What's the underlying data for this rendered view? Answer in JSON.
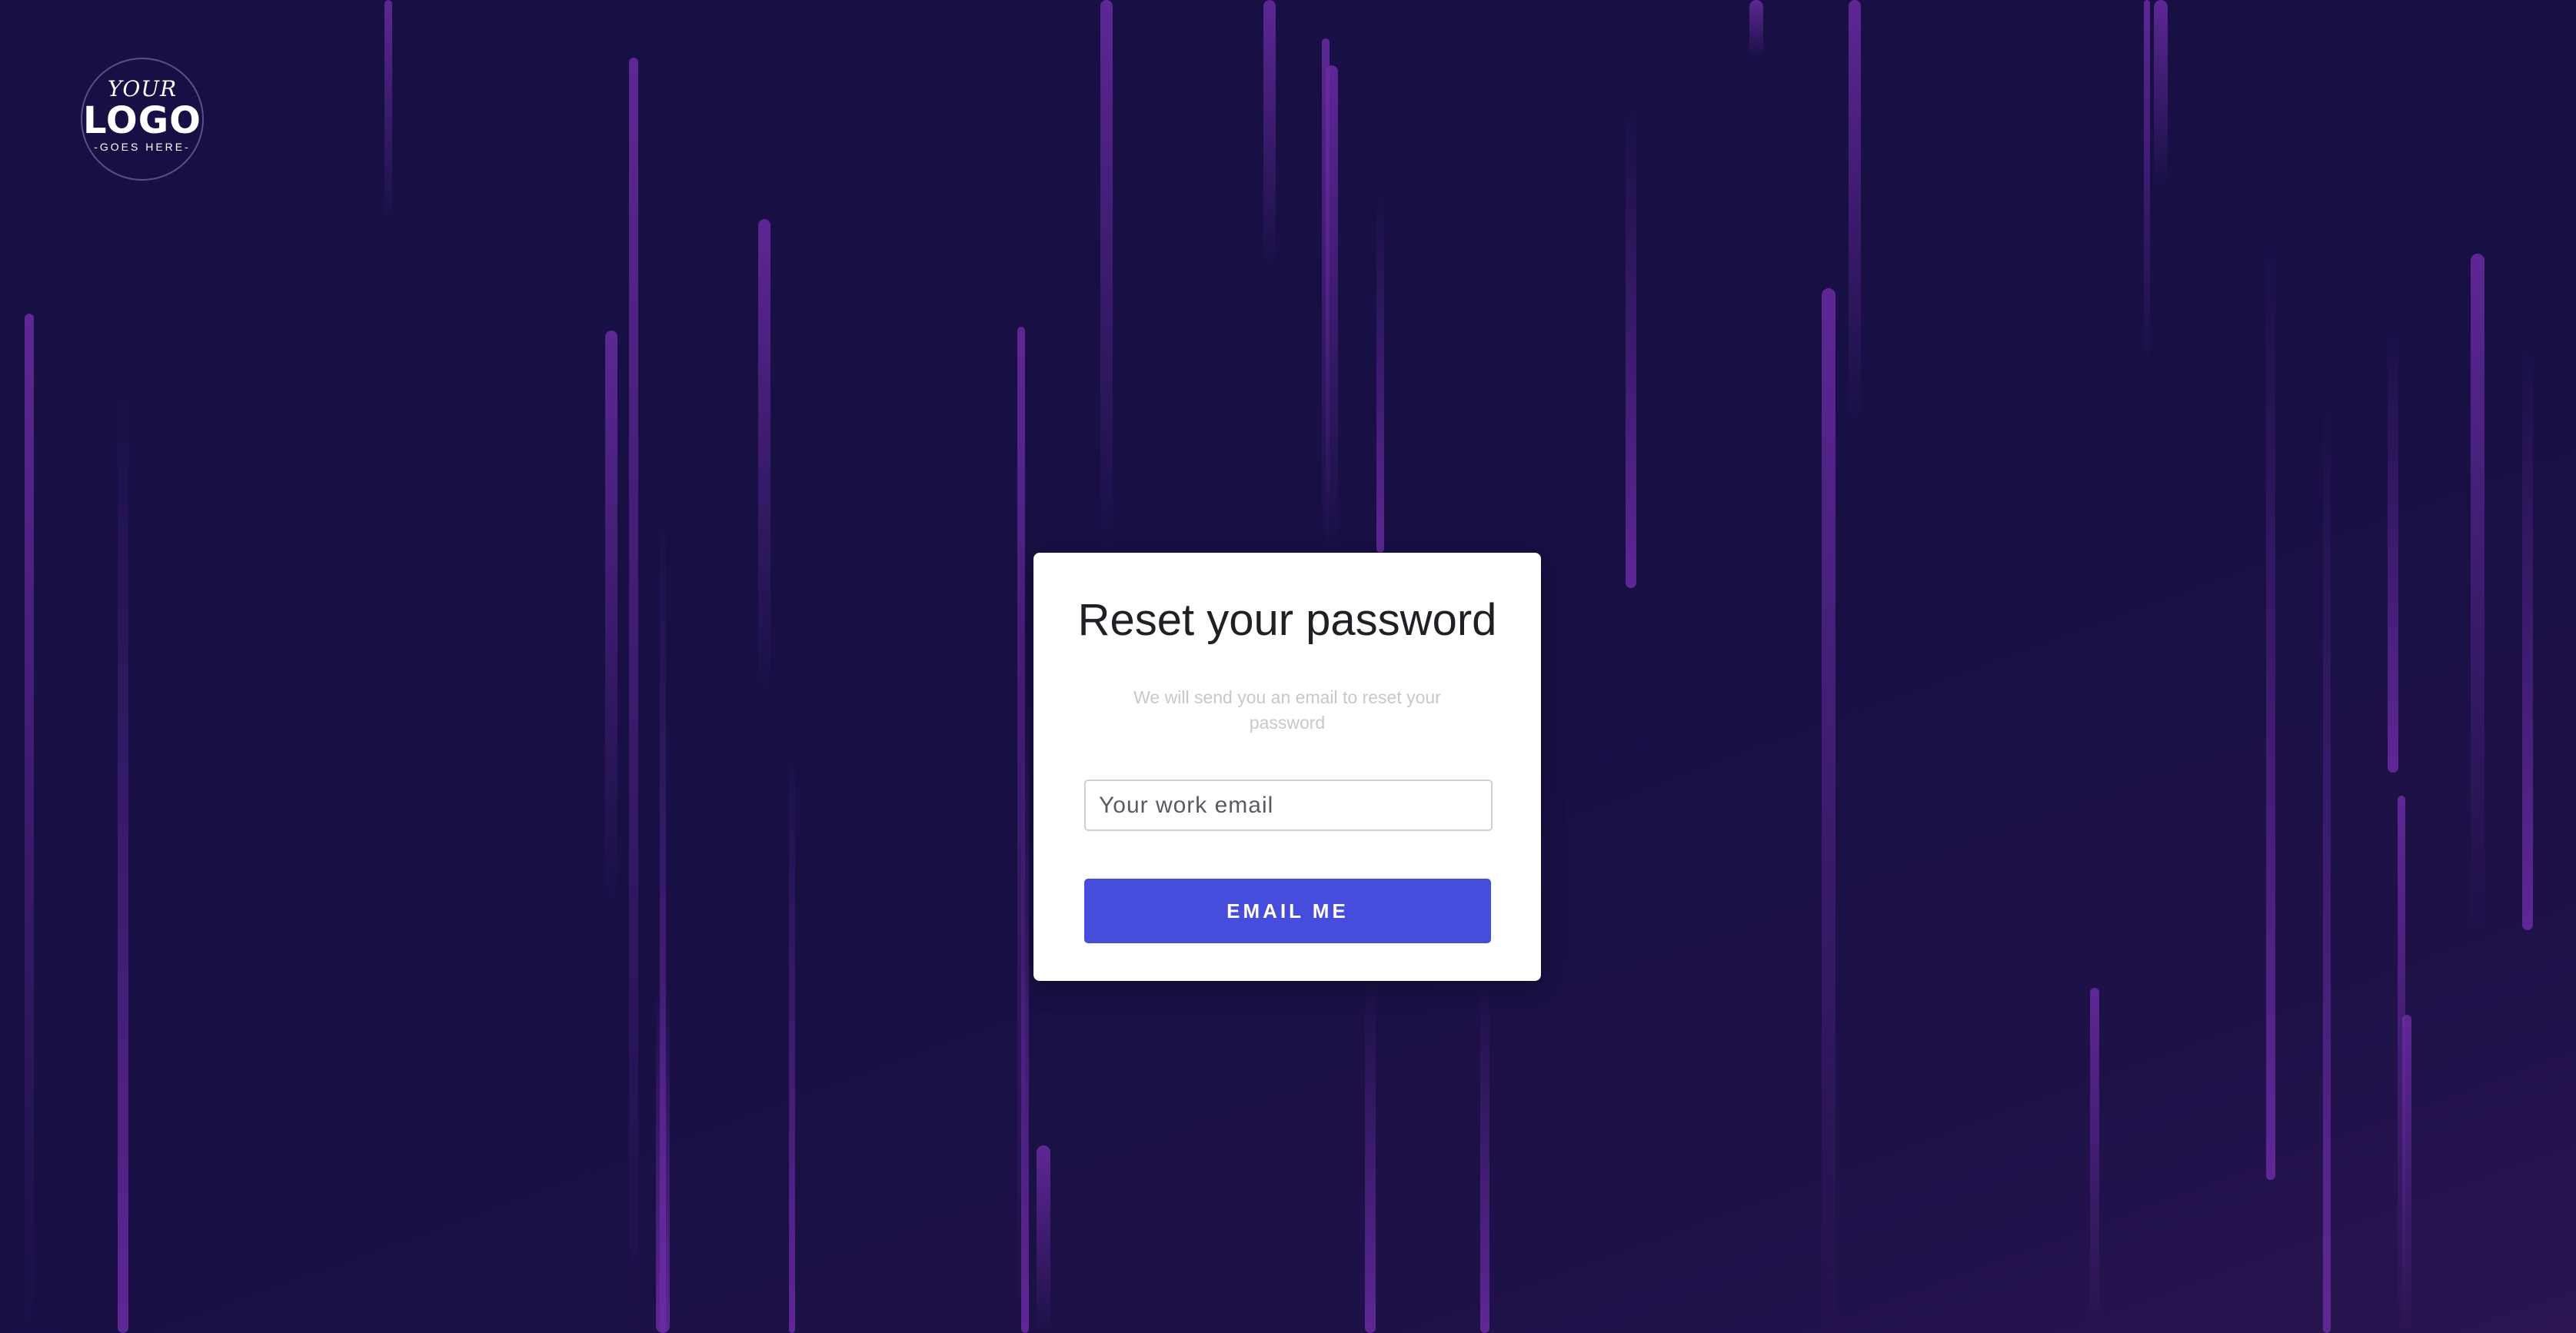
{
  "logo": {
    "line1": "YOUR",
    "line2": "LOGO",
    "line3": "-GOES HERE-"
  },
  "card": {
    "title": "Reset your password",
    "subtitle": "We will send you an email to reset your password",
    "email_placeholder": "Your work email",
    "submit_label": "EMAIL ME"
  },
  "colors": {
    "background": "#180f45",
    "streak": "#6a2ba3",
    "button": "#464ddc",
    "card": "#ffffff"
  }
}
